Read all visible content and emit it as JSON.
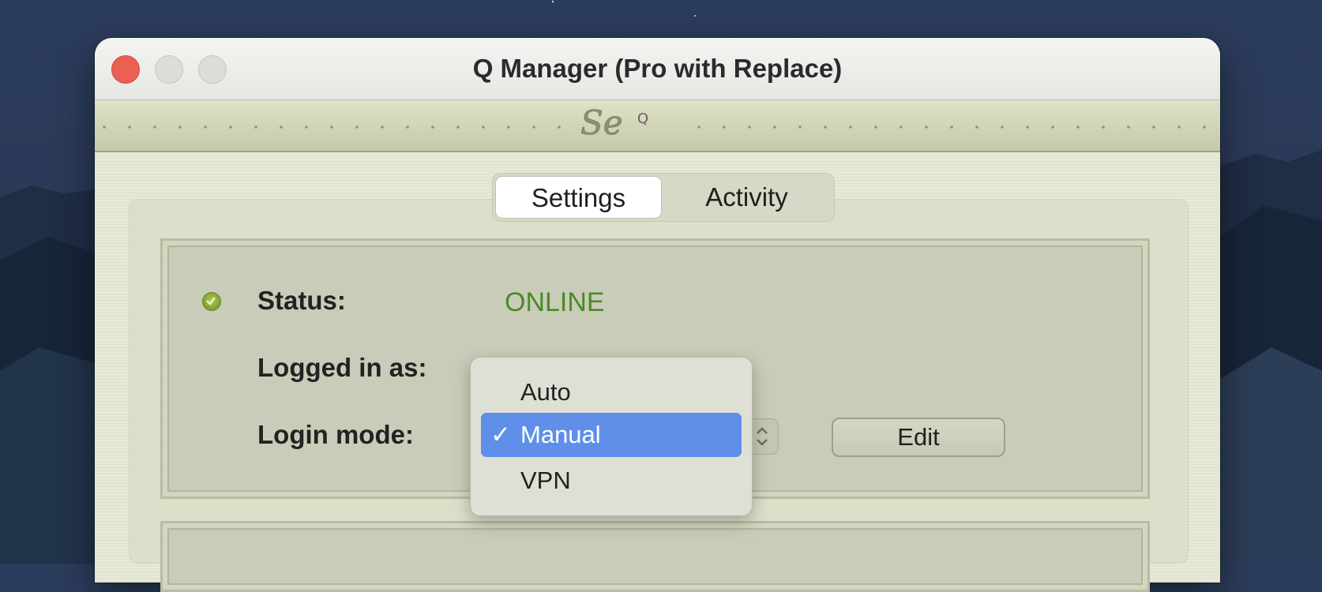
{
  "window": {
    "title": "Q Manager (Pro with Replace)"
  },
  "banner": {
    "logo_text": "Se",
    "logo_sub": "Q"
  },
  "tabs": [
    {
      "label": "Settings",
      "selected": true
    },
    {
      "label": "Activity",
      "selected": false
    }
  ],
  "status": {
    "label": "Status:",
    "value": "ONLINE",
    "value_color": "#4b8a26"
  },
  "logged_in": {
    "label": "Logged in as:"
  },
  "login_mode": {
    "label": "Login mode:",
    "options": [
      {
        "label": "Auto",
        "checked": false
      },
      {
        "label": "Manual",
        "checked": true
      },
      {
        "label": "VPN",
        "checked": false
      }
    ],
    "check_mark": "✓"
  },
  "edit_button": {
    "label": "Edit"
  },
  "colors": {
    "highlight": "#5f8fe8",
    "close": "#ec5f55"
  }
}
